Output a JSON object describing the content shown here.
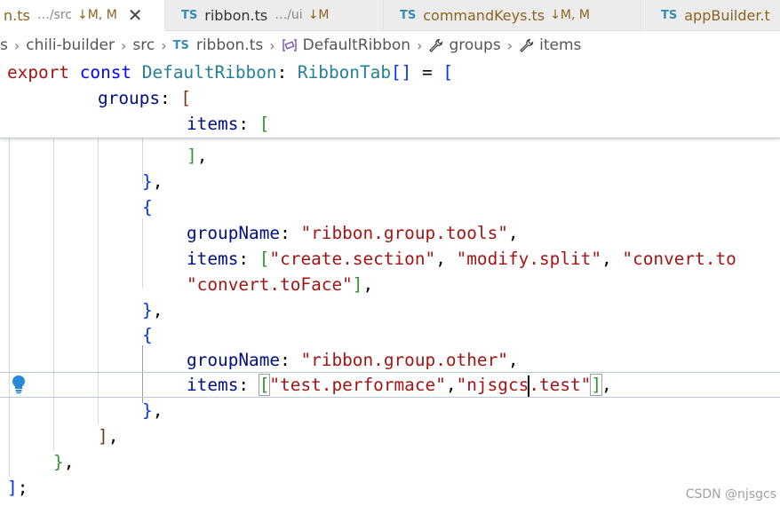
{
  "tabs": [
    {
      "name": "n.ts",
      "desc": "…/src",
      "git": "↓M, M",
      "active": true
    },
    {
      "name": "ribbon.ts",
      "desc": "…/ui",
      "git": "↓M"
    },
    {
      "name": "commandKeys.ts",
      "git": "↓M, M"
    },
    {
      "name": "appBuilder.t"
    }
  ],
  "tab_icon_text": "TS",
  "close_glyph": "✕",
  "breadcrumb": {
    "items": [
      "s",
      "chili-builder",
      "src",
      "ribbon.ts",
      "DefaultRibbon",
      "groups",
      "items"
    ],
    "separator": "›"
  },
  "code": {
    "l1": {
      "export": "export",
      "const": "const",
      "name": "DefaultRibbon",
      "type": "RibbonTab"
    },
    "groups_key": "groups",
    "items_key": "items",
    "group_name_key": "groupName",
    "tools_name": "\"ribbon.group.tools\"",
    "tools_items_1": [
      "\"create.section\"",
      "\"modify.split\"",
      "\"convert.to"
    ],
    "tools_items_2": "\"convert.toFace\"",
    "other_name": "\"ribbon.group.other\"",
    "other_item_1": "\"test.performace\"",
    "other_item_2_a": "\"njsgcs",
    "other_item_2_b": ".test\""
  },
  "watermark": "CSDN @njsgcs",
  "colors": {
    "keyword": "#a31515",
    "type": "#267f99",
    "property": "#001080",
    "string": "#a31515",
    "ts_icon": "#3a8ab8",
    "modified": "#8c6420"
  }
}
